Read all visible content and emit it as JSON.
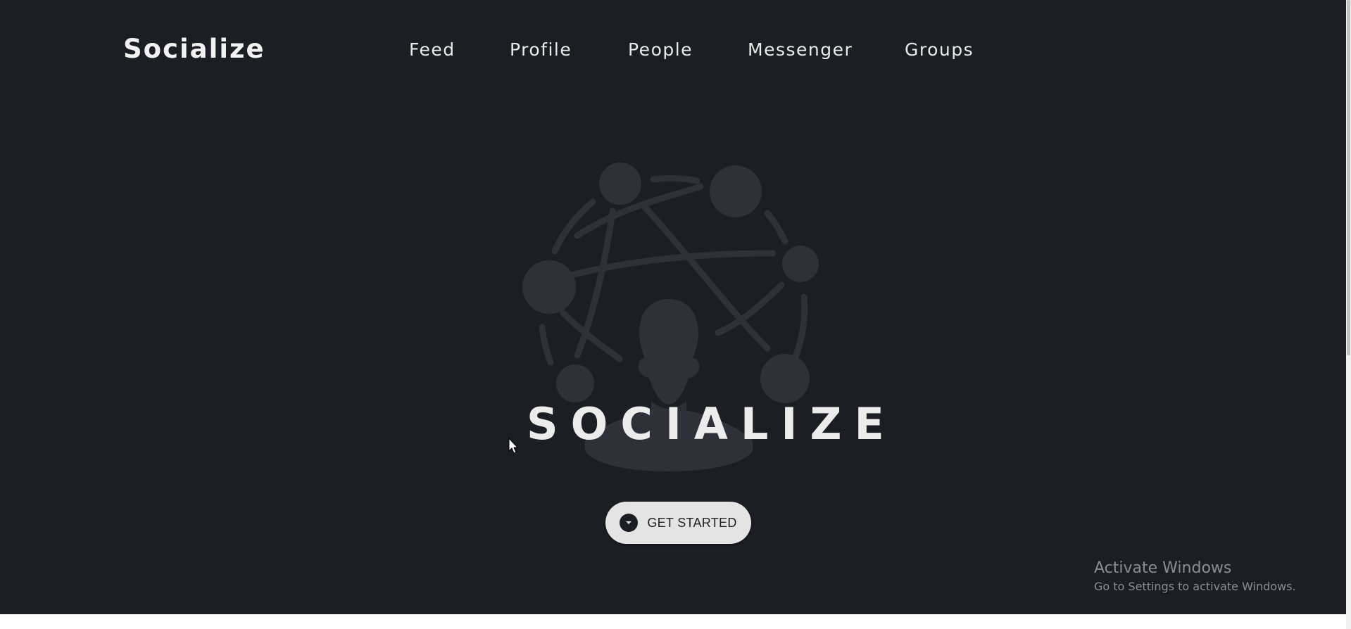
{
  "header": {
    "brand": "Socialize",
    "nav": {
      "feed": "Feed",
      "profile": "Profile",
      "people": "People",
      "messenger": "Messenger",
      "groups": "Groups"
    }
  },
  "hero": {
    "title": "SOCIALIZE",
    "cta_label": "GET STARTED",
    "cta_icon": "chevron-down-circle-icon",
    "background_color": "#1b1e24",
    "logo_color": "#2e3139"
  },
  "watermark": {
    "title": "Activate Windows",
    "subtitle": "Go to Settings to activate Windows."
  }
}
